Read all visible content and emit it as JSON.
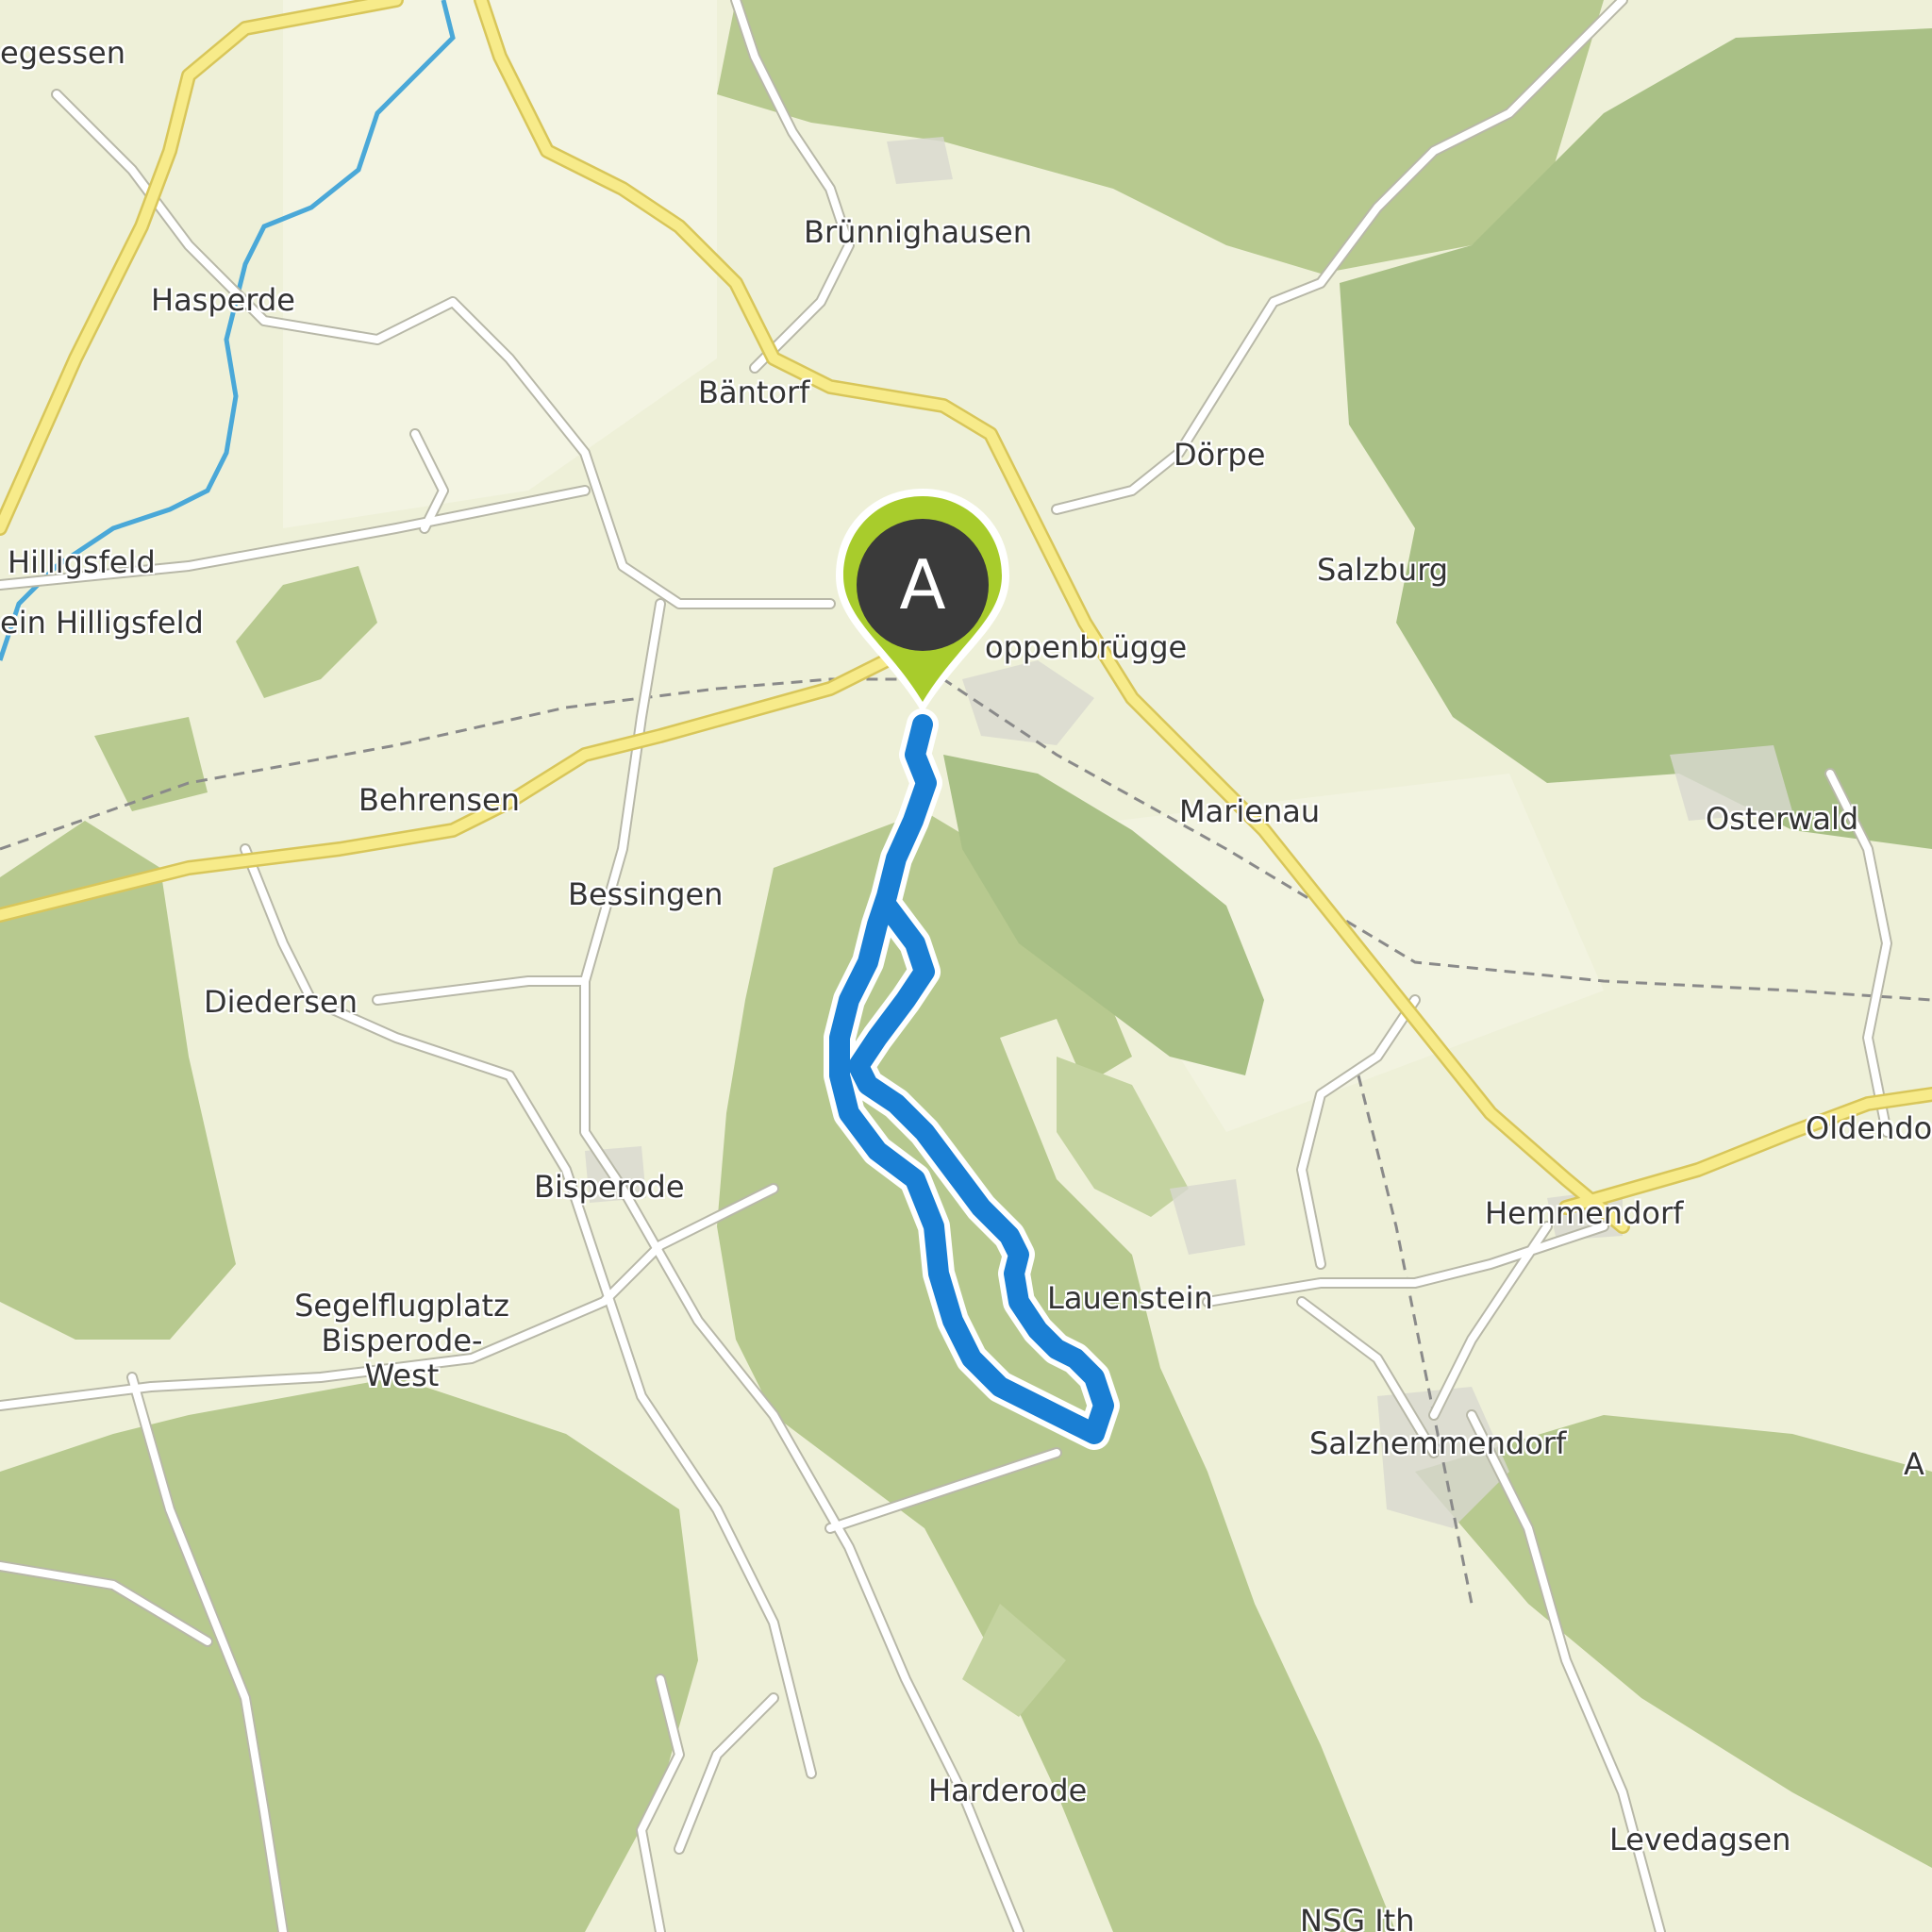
{
  "map": {
    "places": {
      "egessen": "egessen",
      "brunnighausen": "Brünnighausen",
      "hasperde": "Hasperde",
      "bantorf": "Bäntorf",
      "dorpe": "Dörpe",
      "hilligsfeld": "Hilligsfeld",
      "salzburg": "Salzburg",
      "klein_hilligsfeld": "ein Hilligsfeld",
      "coppenbrugge": "oppenbrügge",
      "behrensen": "Behrensen",
      "marienau": "Marienau",
      "osterwald": "Osterwald",
      "bessingen": "Bessingen",
      "diedersen": "Diedersen",
      "oldendorf": "Oldendo",
      "bisperode": "Bisperode",
      "hemmendorf": "Hemmendorf",
      "segelflugplatz_1": "Segelflugplatz",
      "segelflugplatz_2": "Bisperode-",
      "segelflugplatz_3": "West",
      "lauenstein": "Lauenstein",
      "salzhemmendorf": "Salzhemmendorf",
      "edge_a": "A",
      "harderode": "Harderode",
      "levedagsen": "Levedagsen",
      "nsg_ith": "NSG Ith"
    },
    "marker": {
      "label": "A"
    },
    "colors": {
      "background": "#eef0d8",
      "forest": "#b7c98f",
      "forest_dark": "#9fb878",
      "road_major": "#f7eb8a",
      "road_major_casing": "#d8c65a",
      "road_minor": "#ffffff",
      "road_minor_casing": "#b8b8a8",
      "river": "#4aa8d8",
      "route": "#1a7fd4",
      "marker_fill": "#a8cc2c",
      "marker_inner": "#3a3a3a"
    }
  }
}
